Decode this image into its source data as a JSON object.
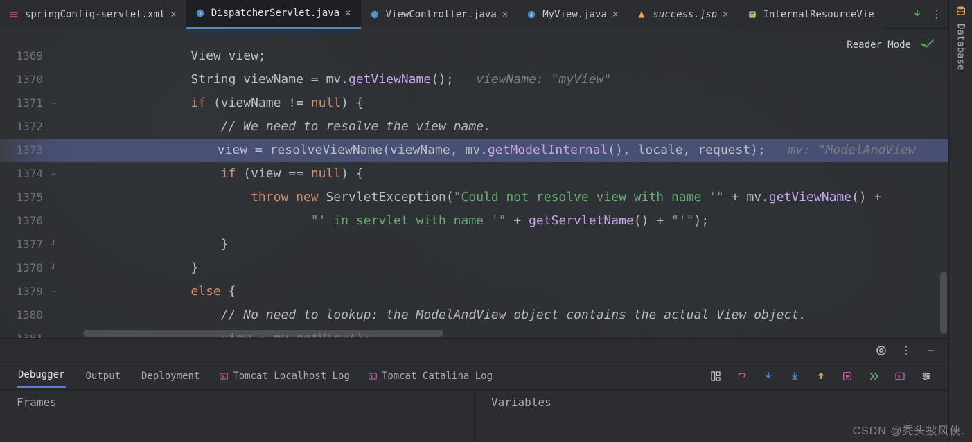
{
  "tabs": [
    {
      "name": "springConfig-servlet.xml",
      "iconType": "xml-red",
      "active": false
    },
    {
      "name": "DispatcherServlet.java",
      "iconType": "java",
      "active": true
    },
    {
      "name": "ViewController.java",
      "iconType": "java",
      "active": false
    },
    {
      "name": "MyView.java",
      "iconType": "java",
      "active": false
    },
    {
      "name": "success.jsp",
      "iconType": "jsp",
      "active": false
    },
    {
      "name": "InternalResourceVie",
      "iconType": "xml-green",
      "active": false,
      "noclose": true
    }
  ],
  "readerMode": "Reader Mode",
  "sidebarRight": {
    "database": "Database"
  },
  "code": {
    "startLine": 1369,
    "lines": [
      {
        "n": 1369,
        "seg": [
          {
            "c": "type",
            "t": "View "
          },
          {
            "c": "var",
            "t": "view;"
          }
        ],
        "indent": 4
      },
      {
        "n": 1370,
        "seg": [
          {
            "c": "type",
            "t": "String "
          },
          {
            "c": "var",
            "t": "viewName = mv."
          },
          {
            "c": "fn",
            "t": "getViewName"
          },
          {
            "c": "pun",
            "t": "();"
          },
          {
            "c": "hint",
            "t": "   viewName: \"myView\""
          }
        ],
        "indent": 4
      },
      {
        "n": 1371,
        "seg": [
          {
            "c": "kw",
            "t": "if "
          },
          {
            "c": "pun",
            "t": "(viewName != "
          },
          {
            "c": "null",
            "t": "null"
          },
          {
            "c": "pun",
            "t": ") {"
          }
        ],
        "indent": 4
      },
      {
        "n": 1372,
        "seg": [
          {
            "c": "cmt2",
            "t": "// We need to resolve the view name."
          }
        ],
        "indent": 5
      },
      {
        "n": 1373,
        "hl": true,
        "seg": [
          {
            "c": "var",
            "t": "view = resolveViewName(viewName, mv."
          },
          {
            "c": "fn",
            "t": "getModelInternal"
          },
          {
            "c": "pun",
            "t": "(), locale, request);"
          },
          {
            "c": "hint",
            "t": "   mv: \"ModelAndView"
          }
        ],
        "indent": 5
      },
      {
        "n": 1374,
        "seg": [
          {
            "c": "kw",
            "t": "if "
          },
          {
            "c": "pun",
            "t": "(view == "
          },
          {
            "c": "null",
            "t": "null"
          },
          {
            "c": "pun",
            "t": ") {"
          }
        ],
        "indent": 5
      },
      {
        "n": 1375,
        "seg": [
          {
            "c": "kw",
            "t": "throw new "
          },
          {
            "c": "type",
            "t": "ServletException("
          },
          {
            "c": "str",
            "t": "\"Could not resolve view with name '\""
          },
          {
            "c": "pun",
            "t": " + mv."
          },
          {
            "c": "fn",
            "t": "getViewName"
          },
          {
            "c": "pun",
            "t": "() +"
          }
        ],
        "indent": 6
      },
      {
        "n": 1376,
        "seg": [
          {
            "c": "str",
            "t": "\"' in servlet with name '\""
          },
          {
            "c": "pun",
            "t": " + "
          },
          {
            "c": "fn",
            "t": "getServletName"
          },
          {
            "c": "pun",
            "t": "() + "
          },
          {
            "c": "str",
            "t": "\"'\""
          },
          {
            "c": "pun",
            "t": ");"
          }
        ],
        "indent": 8
      },
      {
        "n": 1377,
        "seg": [
          {
            "c": "pun",
            "t": "}"
          }
        ],
        "indent": 5
      },
      {
        "n": 1378,
        "seg": [
          {
            "c": "pun",
            "t": "}"
          }
        ],
        "indent": 4
      },
      {
        "n": 1379,
        "seg": [
          {
            "c": "kw",
            "t": "else "
          },
          {
            "c": "pun",
            "t": "{"
          }
        ],
        "indent": 4
      },
      {
        "n": 1380,
        "seg": [
          {
            "c": "cmt2",
            "t": "// No need to lookup: the ModelAndView object contains the actual View object."
          }
        ],
        "indent": 5
      },
      {
        "n": 1381,
        "partial": true,
        "seg": [
          {
            "c": "var",
            "t": "view = mv "
          },
          {
            "c": "fn",
            "t": "getView"
          },
          {
            "c": "pun",
            "t": "()·"
          }
        ],
        "indent": 5
      }
    ]
  },
  "bottomPanel": {
    "tabs": [
      "Debugger",
      "Output",
      "Deployment",
      "Tomcat Localhost Log",
      "Tomcat Catalina Log"
    ],
    "activeTab": 0,
    "frames": "Frames",
    "variables": "Variables"
  },
  "watermark": "CSDN @秃头披风侠."
}
